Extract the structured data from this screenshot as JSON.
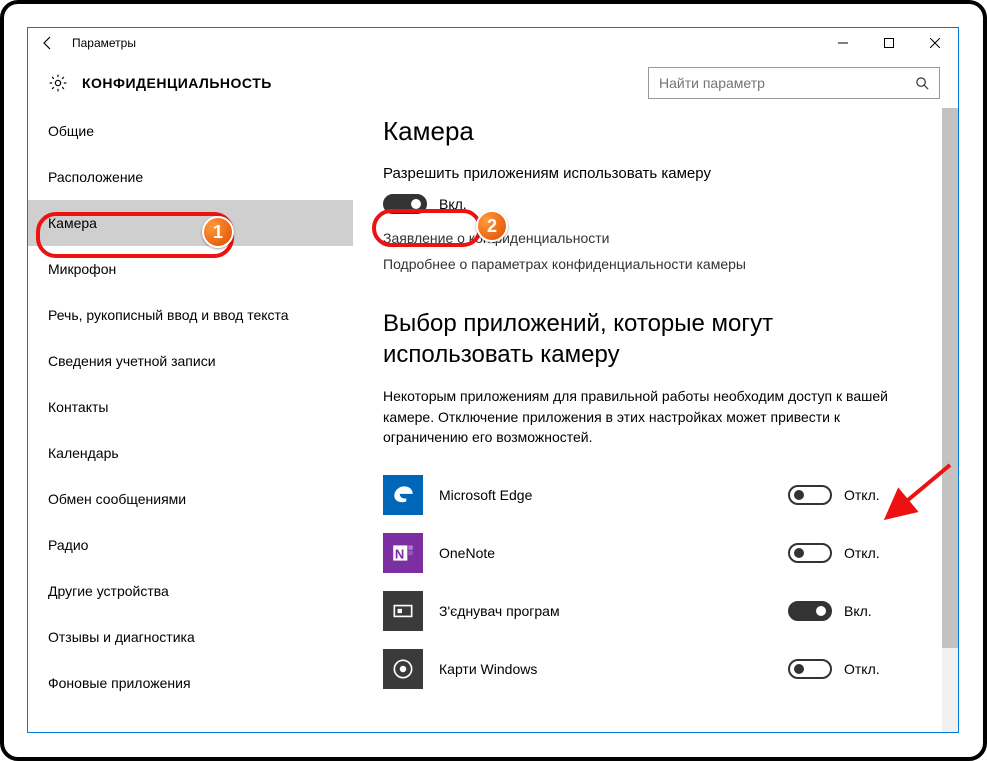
{
  "window": {
    "title": "Параметры"
  },
  "header": {
    "heading": "КОНФИДЕНЦИАЛЬНОСТЬ",
    "search_placeholder": "Найти параметр"
  },
  "sidebar": {
    "items": [
      {
        "label": "Общие"
      },
      {
        "label": "Расположение"
      },
      {
        "label": "Камера"
      },
      {
        "label": "Микрофон"
      },
      {
        "label": "Речь, рукописный ввод и ввод текста"
      },
      {
        "label": "Сведения учетной записи"
      },
      {
        "label": "Контакты"
      },
      {
        "label": "Календарь"
      },
      {
        "label": "Обмен сообщениями"
      },
      {
        "label": "Радио"
      },
      {
        "label": "Другие устройства"
      },
      {
        "label": "Отзывы и диагностика"
      },
      {
        "label": "Фоновые приложения"
      }
    ],
    "selected_index": 2
  },
  "main": {
    "title": "Камера",
    "allow_label": "Разрешить приложениям использовать камеру",
    "allow_state_label": "Вкл.",
    "privacy_link": "Заявление о конфиденциальности",
    "learn_more_link": "Подробнее о параметрах конфиденциальности камеры",
    "choose_heading": "Выбор приложений, которые могут использовать камеру",
    "choose_desc": "Некоторым приложениям для правильной работы необходим доступ к вашей камере. Отключение приложения в этих настройках может привести к ограничению его возможностей.",
    "apps": [
      {
        "name": "Microsoft Edge",
        "state_label": "Откл.",
        "on": false,
        "icon": "edge"
      },
      {
        "name": "OneNote",
        "state_label": "Откл.",
        "on": false,
        "icon": "onenote"
      },
      {
        "name": "З'єднувач програм",
        "state_label": "Вкл.",
        "on": true,
        "icon": "connect"
      },
      {
        "name": "Карти Windows",
        "state_label": "Откл.",
        "on": false,
        "icon": "maps"
      }
    ]
  },
  "annotations": {
    "marker1": "1",
    "marker2": "2"
  }
}
